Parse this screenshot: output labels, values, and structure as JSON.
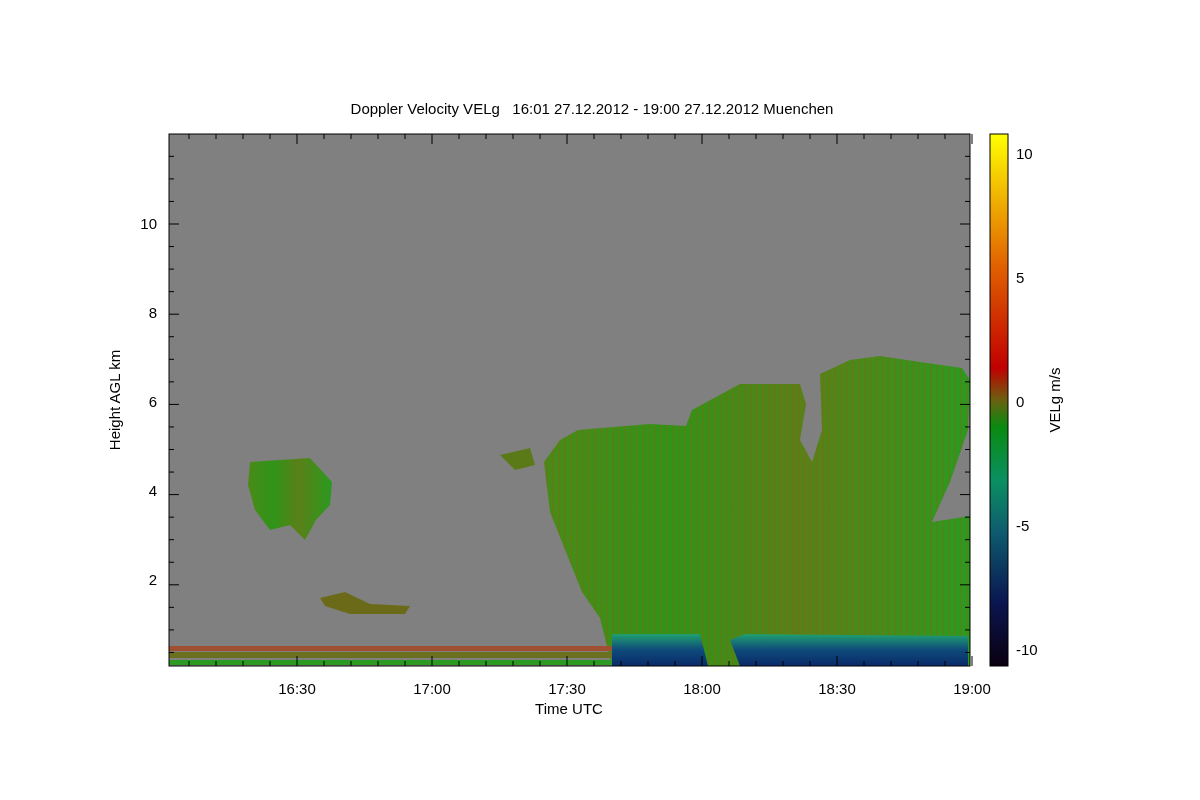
{
  "title": "Doppler Velocity VELg   16:01 27.12.2012 - 19:00 27.12.2012 Muenchen",
  "y_axis": {
    "label": "Height AGL km",
    "ticks": [
      "10",
      "8",
      "6",
      "4",
      "2"
    ]
  },
  "x_axis": {
    "label": "Time UTC",
    "ticks": [
      "16:30",
      "17:00",
      "17:30",
      "18:00",
      "18:30",
      "19:00"
    ]
  },
  "colorbar": {
    "label": "VELg m/s",
    "ticks": [
      "10",
      "5",
      "0",
      "-5",
      "-10"
    ]
  }
}
